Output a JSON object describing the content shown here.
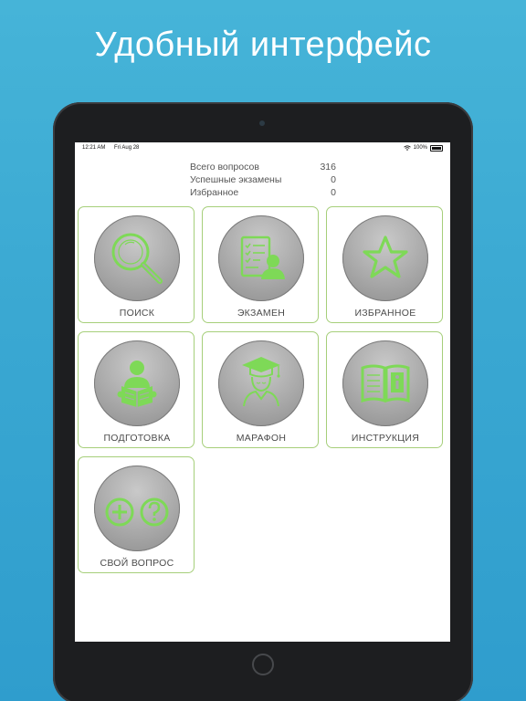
{
  "headline": "Удобный интерфейс",
  "status_bar": {
    "time": "12:21 AM",
    "date": "Fri Aug 28",
    "battery": "100%"
  },
  "stats": [
    {
      "label": "Всего вопросов",
      "value": "316"
    },
    {
      "label": "Успешные экзамены",
      "value": "0"
    },
    {
      "label": "Избранное",
      "value": "0"
    }
  ],
  "tiles": [
    {
      "label": "ПОИСК",
      "icon": "magnifier-icon"
    },
    {
      "label": "ЭКЗАМЕН",
      "icon": "exam-checklist-icon"
    },
    {
      "label": "ИЗБРАННОЕ",
      "icon": "star-icon"
    },
    {
      "label": "ПОДГОТОВКА",
      "icon": "reading-person-icon"
    },
    {
      "label": "МАРАФОН",
      "icon": "graduate-icon"
    },
    {
      "label": "ИНСТРУКЦИЯ",
      "icon": "info-book-icon"
    },
    {
      "label": "СВОЙ ВОПРОС",
      "icon": "add-question-icon"
    }
  ],
  "colors": {
    "accent_green": "#7ed957",
    "tile_border": "#a6cf7a",
    "background_top": "#46b4d8",
    "background_bottom": "#2f9dcd"
  }
}
